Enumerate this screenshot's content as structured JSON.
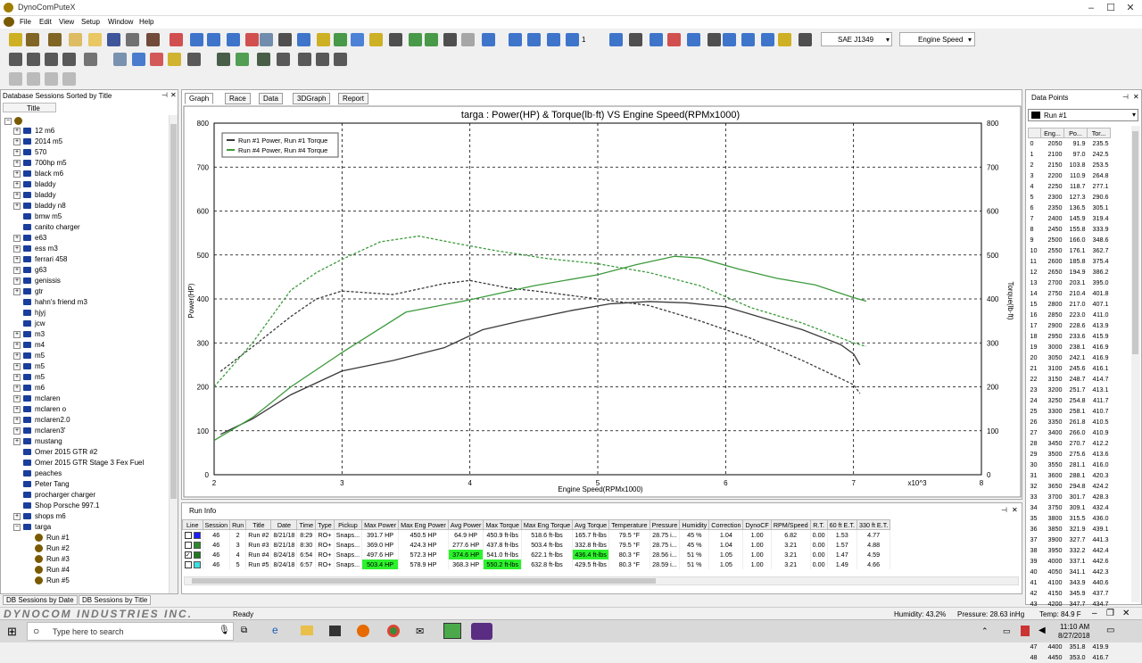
{
  "window": {
    "title": "DynoComPuteX"
  },
  "menu": [
    "File",
    "Edit",
    "View",
    "Setup",
    "Window",
    "Help"
  ],
  "toolbar": {
    "correction": "SAE J1349",
    "xaxis": "Engine Speed",
    "zoom_value": "1"
  },
  "left_panel": {
    "title": "Database Sessions Sorted by Title",
    "column": "Title",
    "items": [
      "12 m6",
      "2014 m5",
      "570",
      "700hp m5",
      "black m6",
      "bladdy",
      "bladdy",
      "bladdy n8",
      "bmw m5",
      "canito charger",
      "e63",
      "ess m3",
      "ferrari 458",
      "g63",
      "genissis",
      "gtr",
      "hahn's friend m3",
      "hjyj",
      "jcw",
      "m3",
      "m4",
      "m5",
      "m5",
      "m5",
      "m6",
      "mclaren",
      "mclaren o",
      "mclaren2.0",
      "mclaren3'",
      "mustang",
      "Omer 2015 GTR #2",
      "Omer 2015 GTR Stage 3 Fex Fuel",
      "peaches",
      "Peter Tang",
      "procharger charger",
      "Shop Porsche 997.1",
      "shops m6",
      "targa"
    ],
    "runs": [
      "Run #1",
      "Run #2",
      "Run #3",
      "Run #4",
      "Run #5"
    ],
    "tab_date": "DB Sessions by Date",
    "tab_title": "DB Sessions by Title"
  },
  "center_tabs": [
    "Graph",
    "Race",
    "Data",
    "3DGraph",
    "Report"
  ],
  "chart_data": {
    "type": "line",
    "title": "targa : Power(HP) & Torque(lb·ft) VS Engine Speed(RPMx1000)",
    "xlabel": "Engine Speed(RPMx1000)",
    "ylabel": "Power(HP)",
    "y2label": "Torque(lb·ft)",
    "x_exponent": "x10^3",
    "xlim": [
      2,
      8
    ],
    "ylim": [
      0,
      800
    ],
    "y2lim": [
      0,
      800
    ],
    "xticks": [
      "2",
      "3",
      "4",
      "5",
      "6",
      "7",
      "8"
    ],
    "yticks": [
      "0",
      "100",
      "200",
      "300",
      "400",
      "500",
      "600",
      "700",
      "800"
    ],
    "grid": true,
    "legend": {
      "position": "top-left",
      "entries": [
        "Run #1 Power, Run #1 Torque",
        "Run #4 Power, Run #4 Torque"
      ]
    },
    "series": [
      {
        "name": "Run #1 Power",
        "color": "#3a3a3a",
        "dash": false,
        "x": [
          2.05,
          2.3,
          2.6,
          3.0,
          3.4,
          3.8,
          4.1,
          4.4,
          4.8,
          5.1,
          5.4,
          5.7,
          6.0,
          6.3,
          6.6,
          6.9,
          7.0,
          7.05
        ],
        "y": [
          92,
          127,
          182,
          236,
          260,
          289,
          330,
          350,
          374,
          389,
          394,
          391,
          382,
          356,
          330,
          296,
          275,
          250
        ]
      },
      {
        "name": "Run #1 Torque",
        "color": "#3a3a3a",
        "dash": true,
        "x": [
          2.05,
          2.3,
          2.6,
          2.8,
          3.0,
          3.4,
          3.8,
          4.0,
          4.3,
          4.6,
          5.0,
          5.4,
          5.8,
          6.2,
          6.6,
          7.0,
          7.05
        ],
        "y": [
          235,
          291,
          360,
          400,
          418,
          410,
          435,
          442,
          425,
          415,
          400,
          385,
          350,
          310,
          260,
          205,
          185
        ]
      },
      {
        "name": "Run #4 Power",
        "color": "#3c9a3c",
        "dash": false,
        "x": [
          2.0,
          2.3,
          2.6,
          3.0,
          3.5,
          4.0,
          4.5,
          5.0,
          5.3,
          5.6,
          5.8,
          6.1,
          6.4,
          6.7,
          7.0,
          7.1
        ],
        "y": [
          78,
          130,
          200,
          278,
          370,
          398,
          430,
          455,
          478,
          497,
          493,
          468,
          447,
          432,
          403,
          395
        ]
      },
      {
        "name": "Run #4 Torque",
        "color": "#3c9a3c",
        "dash": true,
        "x": [
          2.0,
          2.3,
          2.6,
          2.8,
          3.0,
          3.3,
          3.6,
          3.9,
          4.2,
          4.6,
          5.0,
          5.4,
          5.8,
          6.2,
          6.6,
          7.0,
          7.1
        ],
        "y": [
          200,
          300,
          420,
          460,
          490,
          530,
          543,
          526,
          510,
          492,
          480,
          460,
          430,
          380,
          345,
          300,
          292
        ]
      }
    ]
  },
  "run_info": {
    "title": "Run Info",
    "headers": [
      "Line",
      "Session",
      "Run",
      "Title",
      "Date",
      "Time",
      "Type",
      "Pickup",
      "Max Power",
      "Max Eng Power",
      "Avg Power",
      "Max Torque",
      "Max Eng Torque",
      "Avg Torque",
      "Temperature",
      "Pressure",
      "Humidity",
      "Correction",
      "DynoCF",
      "RPM/Speed",
      "R.T.",
      "60 ft E.T.",
      "330 ft E.T."
    ],
    "rows": [
      {
        "color": "#1c1cff",
        "checked": false,
        "cells": [
          "46",
          "2",
          "Run #2",
          "8/21/18",
          "8:29",
          "RO+",
          "Snaps...",
          "391.7 HP",
          "450.5 HP",
          "64.9 HP",
          "450.9 ft-lbs",
          "518.6 ft-lbs",
          "165.7 ft-lbs",
          "79.5 °F",
          "28.75 i...",
          "45 %",
          "1.04",
          "1.00",
          "6.82",
          "0.00",
          "1.53",
          "4.77"
        ]
      },
      {
        "color": "#2a8a2a",
        "checked": false,
        "cells": [
          "46",
          "3",
          "Run #3",
          "8/21/18",
          "8:30",
          "RO+",
          "Snaps...",
          "369.0 HP",
          "424.3 HP",
          "277.6 HP",
          "437.8 ft-lbs",
          "503.4 ft-lbs",
          "332.8 ft-lbs",
          "79.5 °F",
          "28.75 i...",
          "45 %",
          "1.04",
          "1.00",
          "3.21",
          "0.00",
          "1.57",
          "4.88"
        ]
      },
      {
        "color": "#1f7a1f",
        "checked": true,
        "cells": [
          "46",
          "4",
          "Run #4",
          "8/24/18",
          "6:54",
          "RO+",
          "Snaps...",
          "497.6 HP",
          "572.3 HP",
          "374.6 HP",
          "541.0 ft-lbs",
          "622.1 ft-lbs",
          "436.4 ft-lbs",
          "80.3 °F",
          "28.56 i...",
          "51 %",
          "1.05",
          "1.00",
          "3.21",
          "0.00",
          "1.47",
          "4.59"
        ]
      },
      {
        "color": "#3ce0e0",
        "checked": false,
        "cells": [
          "46",
          "5",
          "Run #5",
          "8/24/18",
          "6:57",
          "RO+",
          "Snaps...",
          "503.4 HP",
          "578.9 HP",
          "368.3 HP",
          "550.2 ft-lbs",
          "632.8 ft-lbs",
          "429.5 ft-lbs",
          "80.3 °F",
          "28.59 i...",
          "51 %",
          "1.05",
          "1.00",
          "3.21",
          "0.00",
          "1.49",
          "4.66"
        ]
      }
    ]
  },
  "data_points": {
    "title": "Data Points",
    "selected_run": "Run #1",
    "headers": [
      "",
      "Eng...",
      "Po...",
      "Tor..."
    ],
    "rows": [
      [
        "0",
        "2050",
        "91.9",
        "235.5"
      ],
      [
        "1",
        "2100",
        "97.0",
        "242.5"
      ],
      [
        "2",
        "2150",
        "103.8",
        "253.5"
      ],
      [
        "3",
        "2200",
        "110.9",
        "264.8"
      ],
      [
        "4",
        "2250",
        "118.7",
        "277.1"
      ],
      [
        "5",
        "2300",
        "127.3",
        "290.6"
      ],
      [
        "6",
        "2350",
        "136.5",
        "305.1"
      ],
      [
        "7",
        "2400",
        "145.9",
        "319.4"
      ],
      [
        "8",
        "2450",
        "155.8",
        "333.9"
      ],
      [
        "9",
        "2500",
        "166.0",
        "348.6"
      ],
      [
        "10",
        "2550",
        "176.1",
        "362.7"
      ],
      [
        "11",
        "2600",
        "185.8",
        "375.4"
      ],
      [
        "12",
        "2650",
        "194.9",
        "386.2"
      ],
      [
        "13",
        "2700",
        "203.1",
        "395.0"
      ],
      [
        "14",
        "2750",
        "210.4",
        "401.8"
      ],
      [
        "15",
        "2800",
        "217.0",
        "407.1"
      ],
      [
        "16",
        "2850",
        "223.0",
        "411.0"
      ],
      [
        "17",
        "2900",
        "228.6",
        "413.9"
      ],
      [
        "18",
        "2950",
        "233.6",
        "415.9"
      ],
      [
        "19",
        "3000",
        "238.1",
        "416.9"
      ],
      [
        "20",
        "3050",
        "242.1",
        "416.9"
      ],
      [
        "21",
        "3100",
        "245.6",
        "416.1"
      ],
      [
        "22",
        "3150",
        "248.7",
        "414.7"
      ],
      [
        "23",
        "3200",
        "251.7",
        "413.1"
      ],
      [
        "24",
        "3250",
        "254.8",
        "411.7"
      ],
      [
        "25",
        "3300",
        "258.1",
        "410.7"
      ],
      [
        "26",
        "3350",
        "261.8",
        "410.5"
      ],
      [
        "27",
        "3400",
        "266.0",
        "410.9"
      ],
      [
        "28",
        "3450",
        "270.7",
        "412.2"
      ],
      [
        "29",
        "3500",
        "275.6",
        "413.6"
      ],
      [
        "30",
        "3550",
        "281.1",
        "416.0"
      ],
      [
        "31",
        "3600",
        "288.1",
        "420.3"
      ],
      [
        "32",
        "3650",
        "294.8",
        "424.2"
      ],
      [
        "33",
        "3700",
        "301.7",
        "428.3"
      ],
      [
        "34",
        "3750",
        "309.1",
        "432.4"
      ],
      [
        "35",
        "3800",
        "315.5",
        "436.0"
      ],
      [
        "36",
        "3850",
        "321.9",
        "439.1"
      ],
      [
        "37",
        "3900",
        "327.7",
        "441.3"
      ],
      [
        "38",
        "3950",
        "332.2",
        "442.4"
      ],
      [
        "39",
        "4000",
        "337.1",
        "442.6"
      ],
      [
        "40",
        "4050",
        "341.1",
        "442.3"
      ],
      [
        "41",
        "4100",
        "343.9",
        "440.6"
      ],
      [
        "42",
        "4150",
        "345.9",
        "437.7"
      ],
      [
        "43",
        "4200",
        "347.7",
        "434.7"
      ],
      [
        "44",
        "4250",
        "349.0",
        "431.3"
      ],
      [
        "45",
        "4300",
        "350.0",
        "427.5"
      ],
      [
        "46",
        "4350",
        "351.1",
        "423.9"
      ],
      [
        "47",
        "4400",
        "351.8",
        "419.9"
      ],
      [
        "48",
        "4450",
        "353.0",
        "416.7"
      ]
    ]
  },
  "status": {
    "brand": "DYNOCOM INDUSTRIES INC.",
    "ready": "Ready",
    "humidity": "Humidity: 43.2%",
    "pressure": "Pressure: 28.63 inHg",
    "temp": "Temp: 84.9 F"
  },
  "taskbar": {
    "search_placeholder": "Type here to search",
    "time": "11:10 AM",
    "date": "8/27/2018"
  }
}
